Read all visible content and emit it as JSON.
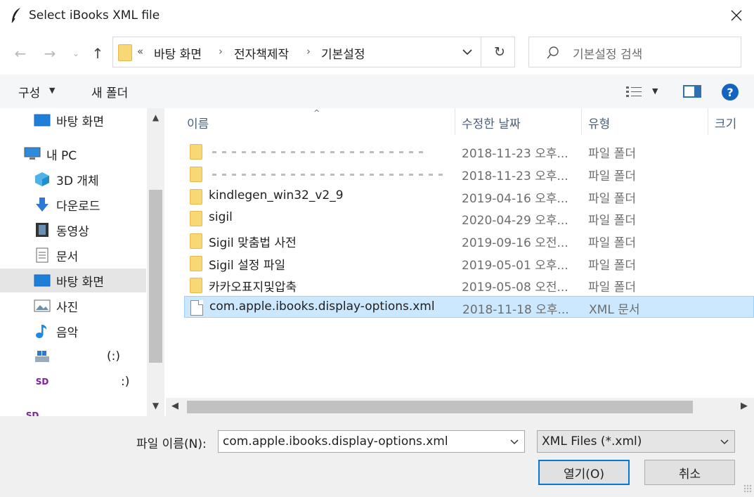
{
  "window": {
    "title": "Select iBooks XML file"
  },
  "nav": {
    "breadcrumb_prefix": "«",
    "breadcrumbs": [
      "바탕 화면",
      "전자책제작",
      "기본설정"
    ],
    "search_placeholder": "기본설정 검색"
  },
  "toolbar": {
    "organize_label": "구성",
    "new_folder_label": "새 폴더"
  },
  "sidebar": {
    "items": [
      {
        "label": "바탕 화면",
        "icon": "desktop-icon"
      },
      {
        "label": "내 PC",
        "icon": "pc-icon"
      },
      {
        "label": "3D 개체",
        "icon": "3d-objects-icon"
      },
      {
        "label": "다운로드",
        "icon": "download-icon"
      },
      {
        "label": "동영상",
        "icon": "video-icon"
      },
      {
        "label": "문서",
        "icon": "document-icon"
      },
      {
        "label": "바탕 화면",
        "icon": "desktop-icon"
      },
      {
        "label": "사진",
        "icon": "pictures-icon"
      },
      {
        "label": "음악",
        "icon": "music-icon"
      },
      {
        "label": "(:)",
        "icon": "drive-icon"
      },
      {
        "label": ":)",
        "icon": "sd-card-icon"
      },
      {
        "label": "",
        "icon": "sd-card-icon"
      }
    ]
  },
  "columns": [
    "이름",
    "수정한 날짜",
    "유형",
    "크기"
  ],
  "files": [
    {
      "name": "",
      "date": "2018-11-23 오후...",
      "type": "파일 폴더",
      "kind": "folder",
      "redacted": true
    },
    {
      "name": "",
      "date": "2018-11-23 오후...",
      "type": "파일 폴더",
      "kind": "folder",
      "redacted": true
    },
    {
      "name": "kindlegen_win32_v2_9",
      "date": "2019-04-16 오후...",
      "type": "파일 폴더",
      "kind": "folder"
    },
    {
      "name": "sigil",
      "date": "2020-04-29 오후...",
      "type": "파일 폴더",
      "kind": "folder"
    },
    {
      "name": "Sigil 맞춤법 사전",
      "date": "2019-09-16 오전...",
      "type": "파일 폴더",
      "kind": "folder"
    },
    {
      "name": "Sigil 설정 파일",
      "date": "2019-05-01 오후...",
      "type": "파일 폴더",
      "kind": "folder"
    },
    {
      "name": "카카오표지및압축",
      "date": "2019-05-08 오전...",
      "type": "파일 폴더",
      "kind": "folder"
    },
    {
      "name": "com.apple.ibooks.display-options.xml",
      "date": "2018-11-18 오후...",
      "type": "XML 문서",
      "kind": "file",
      "selected": true
    }
  ],
  "footer": {
    "filename_label": "파일 이름(N):",
    "filename_value": "com.apple.ibooks.display-options.xml",
    "filter_value": "XML Files (*.xml)",
    "open_label": "열기(O)",
    "cancel_label": "취소"
  },
  "colors": {
    "selection_bg": "#cce8ff",
    "selection_border": "#99d1ff",
    "accent": "#0078d7",
    "folder": "#f8d775"
  }
}
